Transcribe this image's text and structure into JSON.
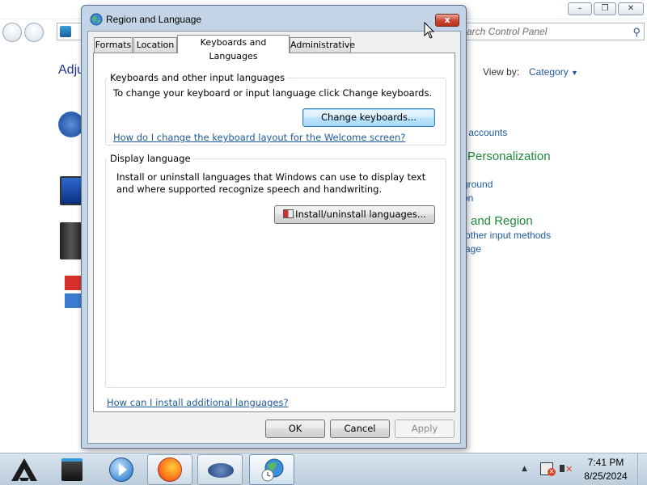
{
  "background": {
    "search_placeholder": "Search Control Panel",
    "search_visible_text": "arch Control Panel",
    "heading_partial": "Adju",
    "view_by_label": "View by:",
    "view_by_value": "Category",
    "links": [
      "r accounts",
      "ground",
      "on",
      "other input methods",
      "age"
    ],
    "headings": [
      "Personalization",
      "and Region"
    ]
  },
  "dialog": {
    "title": "Region and Language",
    "close_glyph": "x",
    "tabs": [
      {
        "label": "Formats"
      },
      {
        "label": "Location"
      },
      {
        "label": "Keyboards and Languages"
      },
      {
        "label": "Administrative"
      }
    ],
    "active_tab": "Keyboards and Languages",
    "keyboards_group": {
      "label": "Keyboards and other input languages",
      "description": "To change your keyboard or input language click Change keyboards.",
      "button": "Change keyboards...",
      "link": "How do I change the keyboard layout for the Welcome screen?"
    },
    "display_group": {
      "label": "Display language",
      "description": "Install or uninstall languages that Windows can use to display text and where supported recognize speech and handwriting.",
      "button": "Install/uninstall languages..."
    },
    "bottom_link": "How can I install additional languages?",
    "buttons": {
      "ok": "OK",
      "cancel": "Cancel",
      "apply": "Apply"
    }
  },
  "taskbar": {
    "time": "7:41 PM",
    "date": "8/25/2024",
    "apps": [
      "start",
      "file-manager",
      "media-player",
      "firefox",
      "network-app",
      "region-language"
    ]
  }
}
